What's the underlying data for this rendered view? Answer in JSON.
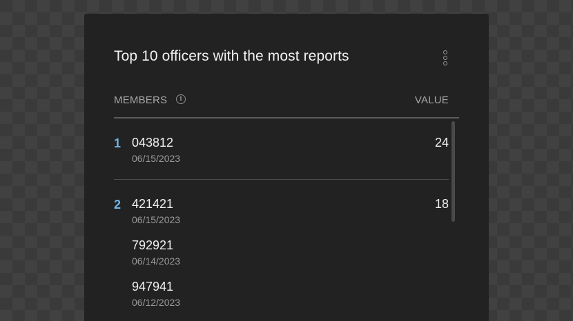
{
  "widget": {
    "title": "Top 10 officers with the most reports",
    "menu_icon": "kebab-vertical-icon",
    "info_icon": "info-icon",
    "columns": {
      "members": "MEMBERS",
      "value": "VALUE"
    },
    "rows": [
      {
        "rank": "1",
        "value": "24",
        "members": [
          {
            "id": "043812",
            "date": "06/15/2023"
          }
        ]
      },
      {
        "rank": "2",
        "value": "18",
        "members": [
          {
            "id": "421421",
            "date": "06/15/2023"
          },
          {
            "id": "792921",
            "date": "06/14/2023"
          },
          {
            "id": "947941",
            "date": "06/12/2023"
          }
        ]
      }
    ]
  },
  "colors": {
    "card_background": "#222222",
    "page_background": "#3a3a3a",
    "rank_accent": "#6fb4e6",
    "primary_text": "#f0f0f0",
    "secondary_text": "#9a9a9a"
  }
}
